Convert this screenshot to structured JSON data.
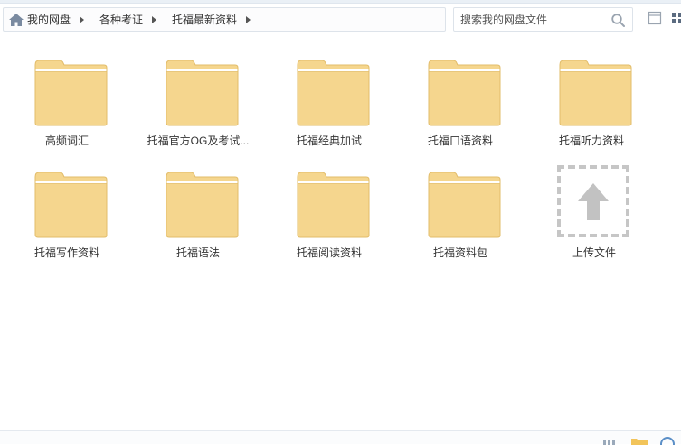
{
  "breadcrumb": {
    "items": [
      {
        "label": "我的网盘"
      },
      {
        "label": "各种考证"
      },
      {
        "label": "托福最新资料"
      }
    ]
  },
  "search": {
    "placeholder": "搜索我的网盘文件"
  },
  "folders": [
    {
      "name": "高频词汇"
    },
    {
      "name": "托福官方OG及考试..."
    },
    {
      "name": "托福经典加试"
    },
    {
      "name": "托福口语资料"
    },
    {
      "name": "托福听力资料"
    },
    {
      "name": "托福写作资料"
    },
    {
      "name": "托福语法"
    },
    {
      "name": "托福阅读资料"
    },
    {
      "name": "托福资料包"
    }
  ],
  "upload": {
    "label": "上传文件"
  },
  "colors": {
    "folder_fill": "#f5d68e",
    "folder_edge": "#e2bc6a",
    "folder_paper": "#ffffff",
    "upload_border": "#c6c6c6",
    "upload_arrow": "#c2c2c2"
  },
  "icons": {
    "home": "home-icon",
    "search": "search-icon",
    "folder": "folder-icon",
    "upload": "upload-arrow-icon",
    "list_view": "list-view-icon",
    "grid_view": "grid-view-icon"
  }
}
